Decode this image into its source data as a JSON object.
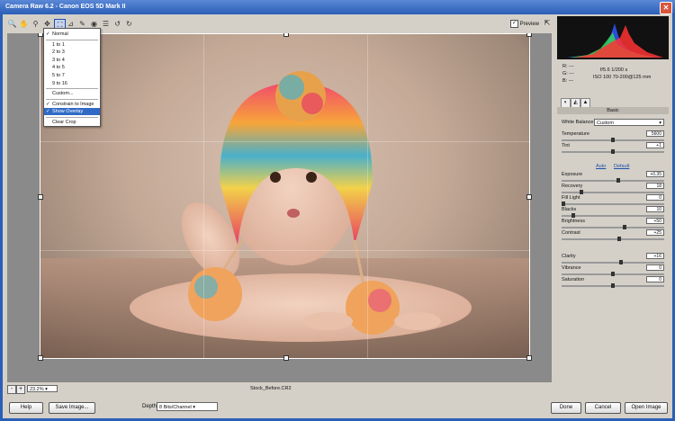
{
  "app": {
    "title": "Camera Raw 6.2 - Canon EOS 5D Mark II",
    "close_glyph": "✕"
  },
  "toolbar": {
    "tools": [
      {
        "name": "zoom-tool",
        "glyph": "🔍"
      },
      {
        "name": "hand-tool",
        "glyph": "✋"
      },
      {
        "name": "white-balance-tool",
        "glyph": "⚲"
      },
      {
        "name": "color-sampler-tool",
        "glyph": "✥"
      },
      {
        "name": "crop-tool",
        "glyph": "⛶",
        "active": true
      },
      {
        "name": "straighten-tool",
        "glyph": "⊿"
      },
      {
        "name": "retouch-tool",
        "glyph": "✎"
      },
      {
        "name": "red-eye-tool",
        "glyph": "◉"
      },
      {
        "name": "preferences-tool",
        "glyph": "☰"
      },
      {
        "name": "rotate-left-tool",
        "glyph": "↺"
      },
      {
        "name": "rotate-right-tool",
        "glyph": "↻"
      }
    ],
    "preview_label": "Preview",
    "preview_checked": "✓",
    "fullscreen_glyph": "⇱"
  },
  "crop_menu": {
    "items": [
      {
        "label": "Normal",
        "checked": true
      },
      {
        "label": "1 to 1"
      },
      {
        "label": "2 to 3"
      },
      {
        "label": "3 to 4"
      },
      {
        "label": "4 to 5"
      },
      {
        "label": "5 to 7"
      },
      {
        "label": "9 to 16"
      },
      {
        "label": "Custom..."
      },
      {
        "label": "Constrain to Image",
        "checked": true
      },
      {
        "label": "Show Overlay",
        "checked": true,
        "selected": true
      },
      {
        "label": "Clear Crop"
      }
    ]
  },
  "status": {
    "zoom_minus": "-",
    "zoom_plus": "+",
    "zoom_value": "23.2%",
    "filename": "Stock_Before.CR2"
  },
  "bottom": {
    "help": "Help",
    "save": "Save Image...",
    "depth_label": "Depth:",
    "depth_value": "8 Bits/Channel",
    "done": "Done",
    "cancel": "Cancel",
    "open": "Open Image"
  },
  "readout": {
    "r": "R:  ---",
    "g": "G:  ---",
    "b": "B:  ---",
    "aperture_shutter": "f/5.6   1/200 s",
    "iso_lens": "ISO 100   70-200@125 mm"
  },
  "panel": {
    "section_title": "Basic",
    "white_balance_label": "White Balance:",
    "white_balance_value": "Custom",
    "auto_label": "Auto",
    "default_label": "Default",
    "controls": [
      {
        "key": "temperature",
        "label": "Temperature",
        "value": "5600",
        "level": 0.5
      },
      {
        "key": "tint",
        "label": "Tint",
        "value": "+1",
        "level": 0.5
      },
      {
        "key": "exposure",
        "label": "Exposure",
        "value": "+0.35",
        "level": 0.55
      },
      {
        "key": "recovery",
        "label": "Recovery",
        "value": "18",
        "level": 0.18
      },
      {
        "key": "fill-light",
        "label": "Fill Light",
        "value": "0",
        "level": 0.0
      },
      {
        "key": "blacks",
        "label": "Blacks",
        "value": "10",
        "level": 0.1
      },
      {
        "key": "brightness",
        "label": "Brightness",
        "value": "+50",
        "level": 0.62
      },
      {
        "key": "contrast",
        "label": "Contrast",
        "value": "+25",
        "level": 0.56
      },
      {
        "key": "clarity",
        "label": "Clarity",
        "value": "+16",
        "level": 0.58
      },
      {
        "key": "vibrance",
        "label": "Vibrance",
        "value": "0",
        "level": 0.5
      },
      {
        "key": "saturation",
        "label": "Saturation",
        "value": "0",
        "level": 0.5
      }
    ]
  },
  "colors": {
    "accent": "#316ac5",
    "title_bar": "#2a5fb8",
    "histogram_bg": "#111111"
  }
}
